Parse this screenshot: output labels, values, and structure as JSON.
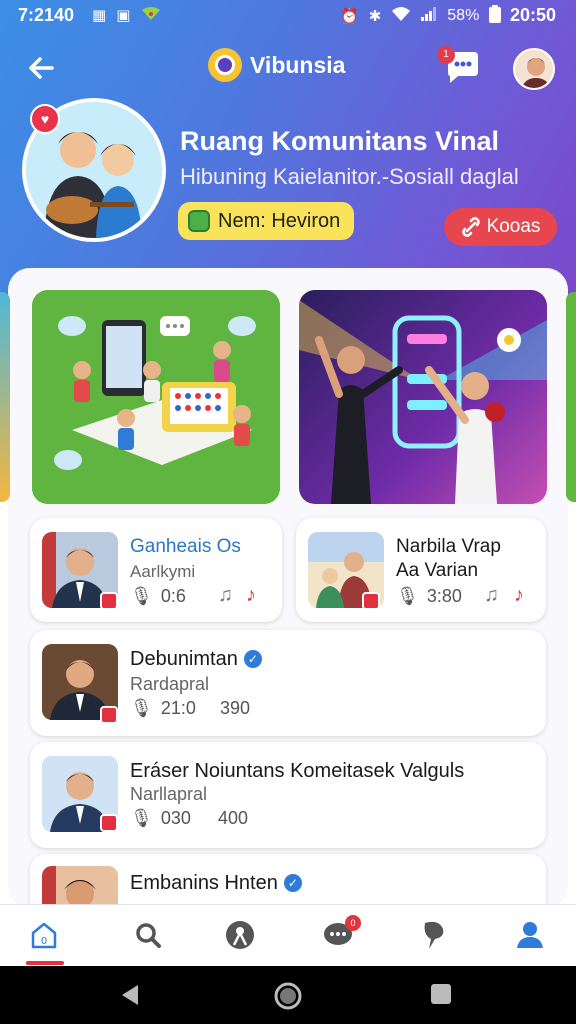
{
  "status_bar": {
    "time": "7:2140",
    "battery": "58%",
    "clock_right": "20:50",
    "icons_left": [
      "grid-icon",
      "square-icon",
      "signal-app-icon"
    ],
    "icons_right": [
      "alarm-icon",
      "bluetooth-icon",
      "wifi-icon",
      "cell-signal-icon",
      "battery-icon"
    ]
  },
  "header": {
    "app_name": "Vibunsia",
    "chat_badge": "1",
    "group_title": "Ruang Komunitans Vinal",
    "group_subtitle": "Hibuning Kaielanitor.-Sosiall daglal",
    "member_label": "Nem: Heviron",
    "join_label": "Kooas"
  },
  "colors": {
    "header_gradient_start": "#3b8fe6",
    "header_gradient_end": "#7b48c9",
    "member_pill": "#f9e35a",
    "join_button": "#e8464f",
    "accent_red": "#e0343f",
    "link_blue": "#2a78c5",
    "verified_blue": "#2f7bd8"
  },
  "posts": [
    {
      "title": "Ganheais Os",
      "subtitle": "Aarlkymi",
      "views": "0:6",
      "icons": [
        "music-note-icon",
        "music-note-red-icon"
      ]
    },
    {
      "title": "Narbila Vrap",
      "subtitle": "Aa Varian",
      "views": "3:80",
      "icons": [
        "music-note-icon",
        "music-note-red-icon"
      ]
    },
    {
      "title": "Debunimtan",
      "subtitle": "Rardapral",
      "views": "21:0",
      "extra": "390",
      "verified": true
    },
    {
      "title": "Eráser Noiuntans Komeitasek Valguls",
      "subtitle": "Narllapral",
      "views": "030",
      "extra": "400"
    },
    {
      "title": "Embanins Hnten",
      "verified": true
    }
  ],
  "bottom_nav": [
    {
      "name": "home",
      "icon": "home-icon",
      "badge": "0"
    },
    {
      "name": "search",
      "icon": "search-icon"
    },
    {
      "name": "explore",
      "icon": "compass-icon"
    },
    {
      "name": "chat",
      "icon": "chat-icon",
      "badge": "0"
    },
    {
      "name": "activity",
      "icon": "pin-icon"
    },
    {
      "name": "profile",
      "icon": "user-icon"
    }
  ]
}
